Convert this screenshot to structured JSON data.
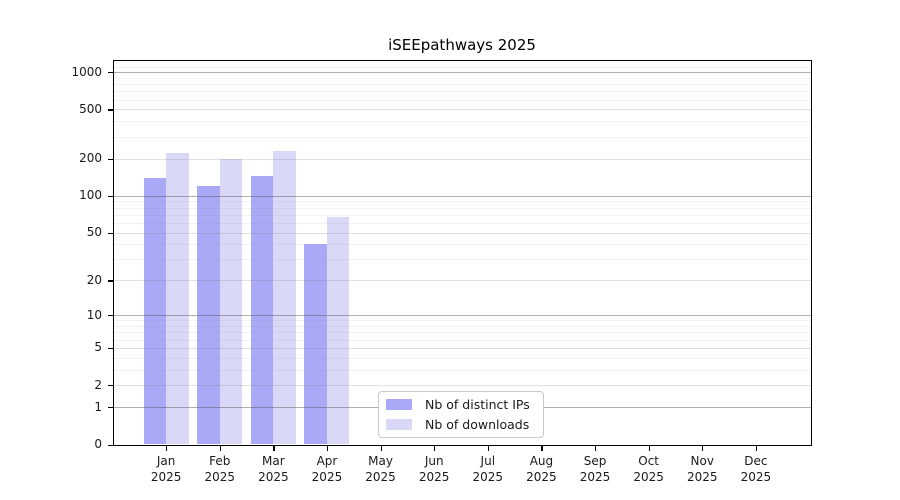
{
  "chart_data": {
    "type": "bar",
    "title": "iSEEpathways 2025",
    "categories": [
      "Jan",
      "Feb",
      "Mar",
      "Apr",
      "May",
      "Jun",
      "Jul",
      "Aug",
      "Sep",
      "Oct",
      "Nov",
      "Dec"
    ],
    "category_year": "2025",
    "series": [
      {
        "name": "Nb of distinct IPs",
        "color": "#a9a9f7",
        "values": [
          140,
          120,
          145,
          40,
          0,
          0,
          0,
          0,
          0,
          0,
          0,
          0
        ]
      },
      {
        "name": "Nb of downloads",
        "color": "#d9d9f7",
        "values": [
          220,
          200,
          230,
          67,
          0,
          0,
          0,
          0,
          0,
          0,
          0,
          0
        ]
      }
    ],
    "yscale": "log1p",
    "ylabel": "",
    "xlabel": "",
    "yticks": [
      0,
      1,
      2,
      5,
      10,
      20,
      50,
      100,
      200,
      500,
      1000
    ],
    "ylim": [
      0,
      1250
    ],
    "grid": "both",
    "legend_position": "lower center"
  }
}
